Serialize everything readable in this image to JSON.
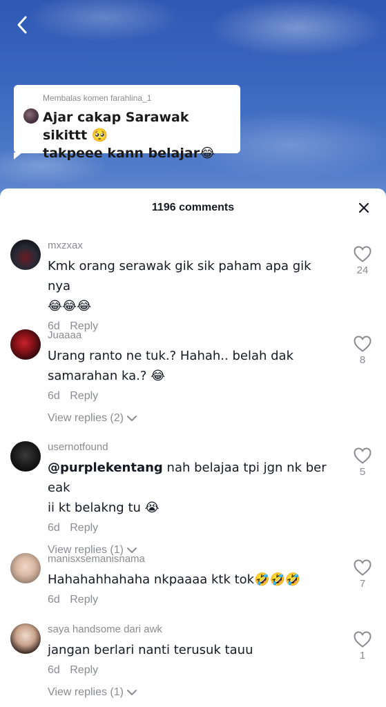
{
  "header": {
    "back_icon": "chevron-left-icon"
  },
  "reply_bubble": {
    "header": "Membalas komen farahlina_1",
    "line1": "Ajar cakap Sarawak sikittt 🥺",
    "line2": "takpeee kann belajar😂"
  },
  "sheet": {
    "title": "1196 comments",
    "close_icon": "close-icon"
  },
  "comments": [
    {
      "username": "mxzxax",
      "line1": "Kmk orang serawak gik sik paham apa gik nya",
      "line2": "😂😂😂",
      "age": "6d",
      "reply": "Reply",
      "likes": "24"
    },
    {
      "username": "Juaaaa",
      "line1": "Urang ranto ne tuk.? Hahah.. belah dak",
      "line2": "samarahan ka.? 😂",
      "age": "6d",
      "reply": "Reply",
      "view_replies": "View replies (2)",
      "likes": "8"
    },
    {
      "username": "usernotfound",
      "mention": "@purplekentang",
      "line1": " nah belajaa tpi jgn nk ber eak",
      "line2": "ii kt belakng tu 😭",
      "age": "6d",
      "reply": "Reply",
      "view_replies": "View replies (1)",
      "likes": "5"
    },
    {
      "username": "manisxsemanisnama",
      "line1": "Hahahahhahaha nkpaaaa ktk tok🤣🤣🤣",
      "age": "6d",
      "reply": "Reply",
      "likes": "7"
    },
    {
      "username": "saya handsome dari awk",
      "line1": "jangan berlari nanti terusuk tauu",
      "age": "6d",
      "reply": "Reply",
      "view_replies": "View replies (1)",
      "likes": "1"
    }
  ],
  "colors": {
    "text_primary": "#161823",
    "text_secondary": "#8a8b91",
    "sheet_bg": "#ffffff"
  }
}
